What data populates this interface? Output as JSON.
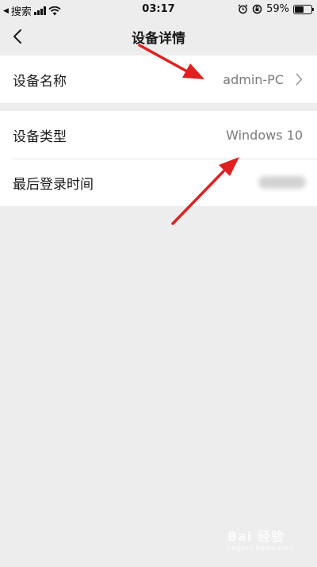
{
  "status_bar": {
    "back_app": "搜索",
    "time": "03:17",
    "battery_percent": "59%",
    "battery_level": 0.59
  },
  "nav": {
    "title": "设备详情"
  },
  "section1": {
    "rows": [
      {
        "label": "设备名称",
        "value": "admin-PC"
      }
    ]
  },
  "section2": {
    "rows": [
      {
        "label": "设备类型",
        "value": "Windows 10"
      },
      {
        "label": "最后登录时间",
        "value": ""
      }
    ]
  },
  "watermark": {
    "brand": "Bai 经验",
    "sub": "jingyan.baidu.com"
  },
  "colors": {
    "background": "#ededed",
    "card": "#ffffff",
    "value_text": "#7a7a7a",
    "annotation_arrow": "#e02020"
  }
}
